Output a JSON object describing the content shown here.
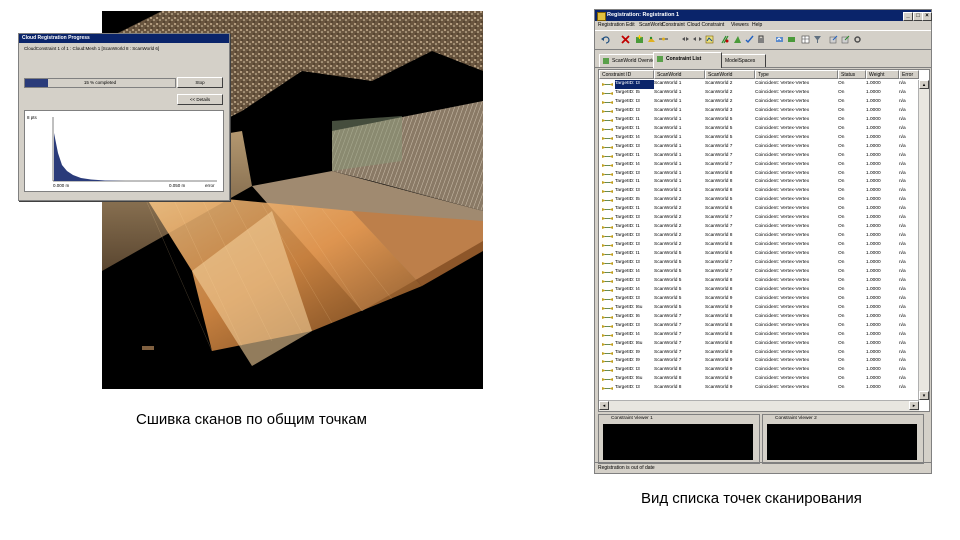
{
  "left_caption": "Сшивка сканов по общим точкам",
  "right_caption": "Вид списка точек сканирования",
  "progress_dialog": {
    "title": "Cloud Registration Progress",
    "info": "CloudConstraint 1 of 1 : Cloud:Mesh 1 [ScanWorld 8 : ScanWorld 6]",
    "progress_text": "15 % completed",
    "progress_value": 0.15,
    "stop_label": "Stop",
    "details_label": "<< Details",
    "y_label": "8 pts",
    "x_min_label": "0.000 m",
    "x_mid_label": "0.050 m",
    "x_unit_label": "error"
  },
  "window": {
    "title": "Registration: Registration 1",
    "menu": [
      "Registration",
      "Edit",
      "ScanWorld",
      "Constraint",
      "Cloud Constraint",
      "Viewers",
      "Help"
    ],
    "tabs": [
      "ScanWorld Overview",
      "Constraint List",
      "ModelSpaces"
    ],
    "active_tab": 1,
    "columns": [
      "Constraint ID",
      "ScanWorld",
      "ScanWorld",
      "Type",
      "Status",
      "Weight",
      "Error"
    ],
    "rows": [
      [
        "TargetID: t3",
        "ScanWorld 1",
        "ScanWorld 2",
        "Coincident: Vertex-Vertex",
        "On",
        "1.0000",
        "n/a"
      ],
      [
        "TargetID: t5",
        "ScanWorld 1",
        "ScanWorld 2",
        "Coincident: Vertex-Vertex",
        "On",
        "1.0000",
        "n/a"
      ],
      [
        "TargetID: t3",
        "ScanWorld 1",
        "ScanWorld 2",
        "Coincident: Vertex-Vertex",
        "On",
        "1.0000",
        "n/a"
      ],
      [
        "TargetID: t3",
        "ScanWorld 1",
        "ScanWorld 3",
        "Coincident: Vertex-Vertex",
        "On",
        "1.0000",
        "n/a"
      ],
      [
        "TargetID: t1",
        "ScanWorld 1",
        "ScanWorld 5",
        "Coincident: Vertex-Vertex",
        "On",
        "1.0000",
        "n/a"
      ],
      [
        "TargetID: t1",
        "ScanWorld 1",
        "ScanWorld 5",
        "Coincident: Vertex-Vertex",
        "On",
        "1.0000",
        "n/a"
      ],
      [
        "TargetID: t4",
        "ScanWorld 1",
        "ScanWorld 5",
        "Coincident: Vertex-Vertex",
        "On",
        "1.0000",
        "n/a"
      ],
      [
        "TargetID: t3",
        "ScanWorld 1",
        "ScanWorld 7",
        "Coincident: Vertex-Vertex",
        "On",
        "1.0000",
        "n/a"
      ],
      [
        "TargetID: t1",
        "ScanWorld 1",
        "ScanWorld 7",
        "Coincident: Vertex-Vertex",
        "On",
        "1.0000",
        "n/a"
      ],
      [
        "TargetID: t4",
        "ScanWorld 1",
        "ScanWorld 7",
        "Coincident: Vertex-Vertex",
        "On",
        "1.0000",
        "n/a"
      ],
      [
        "TargetID: t3",
        "ScanWorld 1",
        "ScanWorld 8",
        "Coincident: Vertex-Vertex",
        "On",
        "1.0000",
        "n/a"
      ],
      [
        "TargetID: t1",
        "ScanWorld 1",
        "ScanWorld 8",
        "Coincident: Vertex-Vertex",
        "On",
        "1.0000",
        "n/a"
      ],
      [
        "TargetID: t3",
        "ScanWorld 1",
        "ScanWorld 8",
        "Coincident: Vertex-Vertex",
        "On",
        "1.0000",
        "n/a"
      ],
      [
        "TargetID: t5",
        "ScanWorld 2",
        "ScanWorld 5",
        "Coincident: Vertex-Vertex",
        "On",
        "1.0000",
        "n/a"
      ],
      [
        "TargetID: t1",
        "ScanWorld 2",
        "ScanWorld 6",
        "Coincident: Vertex-Vertex",
        "On",
        "1.0000",
        "n/a"
      ],
      [
        "TargetID: t3",
        "ScanWorld 2",
        "ScanWorld 7",
        "Coincident: Vertex-Vertex",
        "On",
        "1.0000",
        "n/a"
      ],
      [
        "TargetID: t1",
        "ScanWorld 2",
        "ScanWorld 7",
        "Coincident: Vertex-Vertex",
        "On",
        "1.0000",
        "n/a"
      ],
      [
        "TargetID: t3",
        "ScanWorld 2",
        "ScanWorld 8",
        "Coincident: Vertex-Vertex",
        "On",
        "1.0000",
        "n/a"
      ],
      [
        "TargetID: t3",
        "ScanWorld 2",
        "ScanWorld 8",
        "Coincident: Vertex-Vertex",
        "On",
        "1.0000",
        "n/a"
      ],
      [
        "TargetID: t1",
        "ScanWorld 5",
        "ScanWorld 6",
        "Coincident: Vertex-Vertex",
        "On",
        "1.0000",
        "n/a"
      ],
      [
        "TargetID: t3",
        "ScanWorld 5",
        "ScanWorld 7",
        "Coincident: Vertex-Vertex",
        "On",
        "1.0000",
        "n/a"
      ],
      [
        "TargetID: t4",
        "ScanWorld 5",
        "ScanWorld 7",
        "Coincident: Vertex-Vertex",
        "On",
        "1.0000",
        "n/a"
      ],
      [
        "TargetID: t3",
        "ScanWorld 5",
        "ScanWorld 8",
        "Coincident: Vertex-Vertex",
        "On",
        "1.0000",
        "n/a"
      ],
      [
        "TargetID: t4",
        "ScanWorld 5",
        "ScanWorld 8",
        "Coincident: Vertex-Vertex",
        "On",
        "1.0000",
        "n/a"
      ],
      [
        "TargetID: t3",
        "ScanWorld 5",
        "ScanWorld 9",
        "Coincident: Vertex-Vertex",
        "On",
        "1.0000",
        "n/a"
      ],
      [
        "TargetID: t6u",
        "ScanWorld 5",
        "ScanWorld 9",
        "Coincident: Vertex-Vertex",
        "On",
        "1.0000",
        "n/a"
      ],
      [
        "TargetID: t6",
        "ScanWorld 7",
        "ScanWorld 8",
        "Coincident: Vertex-Vertex",
        "On",
        "1.0000",
        "n/a"
      ],
      [
        "TargetID: t3",
        "ScanWorld 7",
        "ScanWorld 8",
        "Coincident: Vertex-Vertex",
        "On",
        "1.0000",
        "n/a"
      ],
      [
        "TargetID: t4",
        "ScanWorld 7",
        "ScanWorld 8",
        "Coincident: Vertex-Vertex",
        "On",
        "1.0000",
        "n/a"
      ],
      [
        "TargetID: t6u",
        "ScanWorld 7",
        "ScanWorld 8",
        "Coincident: Vertex-Vertex",
        "On",
        "1.0000",
        "n/a"
      ],
      [
        "TargetID: t9",
        "ScanWorld 7",
        "ScanWorld 9",
        "Coincident: Vertex-Vertex",
        "On",
        "1.0000",
        "n/a"
      ],
      [
        "TargetID: t9",
        "ScanWorld 7",
        "ScanWorld 9",
        "Coincident: Vertex-Vertex",
        "On",
        "1.0000",
        "n/a"
      ],
      [
        "TargetID: t3",
        "ScanWorld 8",
        "ScanWorld 9",
        "Coincident: Vertex-Vertex",
        "On",
        "1.0000",
        "n/a"
      ],
      [
        "TargetID: t6u",
        "ScanWorld 8",
        "ScanWorld 9",
        "Coincident: Vertex-Vertex",
        "On",
        "1.0000",
        "n/a"
      ],
      [
        "TargetID: t3",
        "ScanWorld 8",
        "ScanWorld 9",
        "Coincident: Vertex-Vertex",
        "On",
        "1.0000",
        "n/a"
      ]
    ],
    "viewer1_title": "Constraint Viewer 1",
    "viewer2_title": "Constraint Viewer 2",
    "status": "Registration is out of date"
  },
  "colors": {
    "title_bar": "#0a246a",
    "selection": "#0a246a",
    "cloud_orange": "#e8964a"
  }
}
